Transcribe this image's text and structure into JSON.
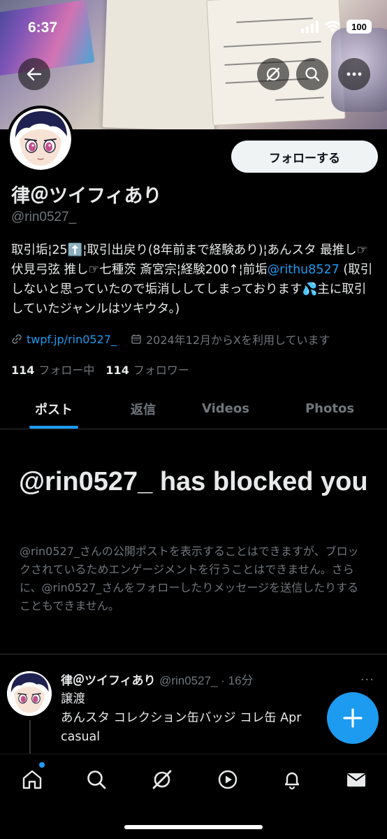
{
  "status": {
    "time": "6:37",
    "battery": "100"
  },
  "profile": {
    "name": "律＠ツイフィあり",
    "handle": "@rin0527_",
    "follow_label": "フォローする",
    "bio_part1": "取引垢¦25⬆️¦取引出戻り(8年前まで経験あり)¦あんスタ 最推し☞伏見弓弦 推し☞七種茨 斎宮宗¦経験200↑¦前垢",
    "bio_mention": "@rithu8527",
    "bio_part2": " (取引しないと思っていたので垢消ししてしまっております💦主に取引していたジャンルはツキウタ。)",
    "link": "twpf.jp/rin0527_",
    "joined": "2024年12月からXを利用しています",
    "following_count": "114",
    "following_label": "フォロー中",
    "followers_count": "114",
    "followers_label": "フォロワー"
  },
  "tabs": [
    {
      "label": "ポスト"
    },
    {
      "label": "返信"
    },
    {
      "label": "Videos"
    },
    {
      "label": "Photos"
    }
  ],
  "blocked": {
    "title": "@rin0527_ has blocked you",
    "description": "@rin0527_さんの公開ポストを表示することはできますが、ブロックされているためエンゲージメントを行うことはできません。さらに、@rin0527_さんをフォローしたりメッセージを送信したりすることもできません。"
  },
  "post": {
    "name": "律＠ツイフィあり",
    "meta": "@rin0527_ · 16分",
    "more": "···",
    "line1": "譲渡",
    "line2": "あんスタ コレクション缶バッジ コレ缶 Apr",
    "line3": "casual"
  },
  "colors": {
    "accent": "#1d9bf0",
    "background": "#000000",
    "muted": "#71767b"
  },
  "icons": [
    "back-arrow-icon",
    "grok-icon",
    "search-icon",
    "more-icon",
    "link-icon",
    "calendar-icon",
    "plus-icon",
    "home-icon",
    "explore-icon",
    "grok-nav-icon",
    "video-icon",
    "notifications-icon",
    "messages-icon"
  ]
}
